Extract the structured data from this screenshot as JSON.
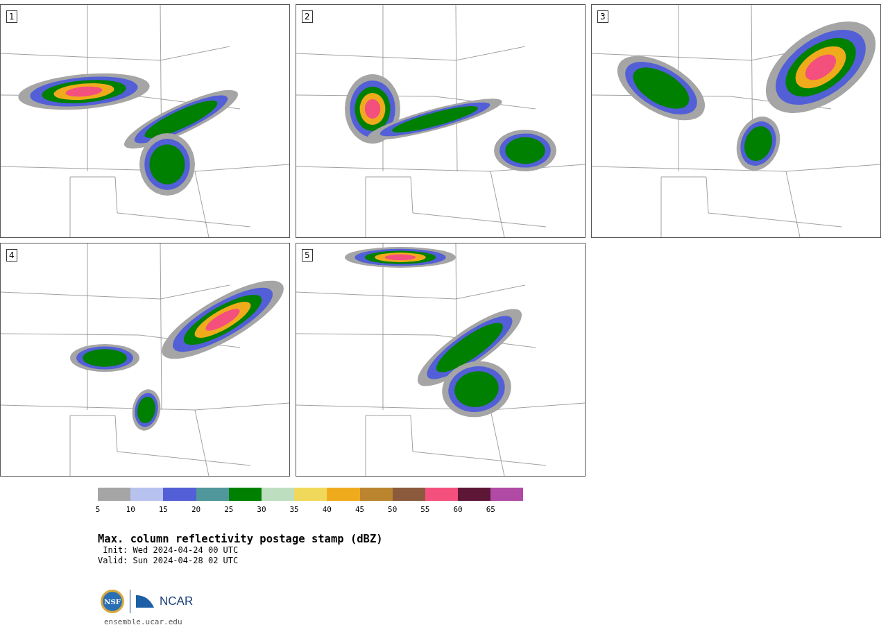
{
  "panels": [
    {
      "label": "1"
    },
    {
      "label": "2"
    },
    {
      "label": "3"
    },
    {
      "label": "4"
    },
    {
      "label": "5"
    }
  ],
  "colorbar": [
    {
      "color": "#a5a5a5",
      "tick": "5"
    },
    {
      "color": "#b8c2ef",
      "tick": "10"
    },
    {
      "color": "#525fd6",
      "tick": "15"
    },
    {
      "color": "#4f979a",
      "tick": "20"
    },
    {
      "color": "#008000",
      "tick": "25"
    },
    {
      "color": "#bedfbf",
      "tick": "30"
    },
    {
      "color": "#f0d95a",
      "tick": "35"
    },
    {
      "color": "#f0ab1c",
      "tick": "40"
    },
    {
      "color": "#bb842f",
      "tick": "45"
    },
    {
      "color": "#8b5a3d",
      "tick": "50"
    },
    {
      "color": "#f4507e",
      "tick": "55"
    },
    {
      "color": "#5e1637",
      "tick": "60"
    },
    {
      "color": "#b04aa5",
      "tick": "65"
    }
  ],
  "title": "Max. column reflectivity postage stamp (dBZ)",
  "init": " Init: Wed 2024-04-24 00 UTC",
  "valid": "Valid: Sun 2024-04-28 02 UTC",
  "logo": {
    "nsf": "NSF",
    "ncar": "NCAR"
  },
  "url": "ensemble.ucar.edu"
}
